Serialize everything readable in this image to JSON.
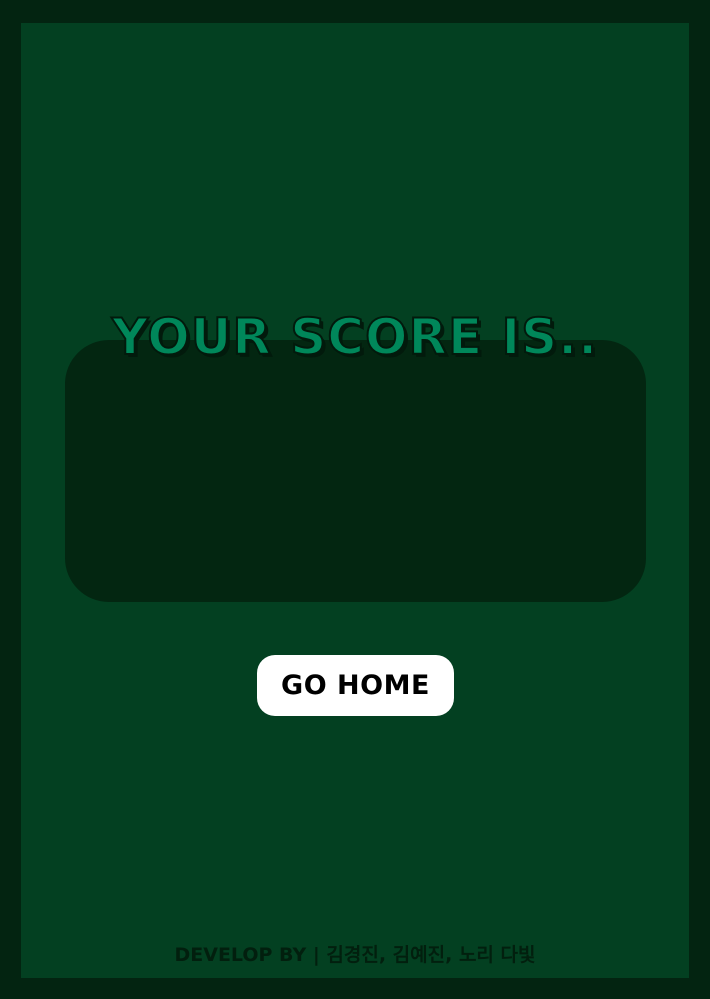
{
  "result": {
    "title": "YOUR SCORE IS..",
    "score": ""
  },
  "actions": {
    "home_label": "GO HOME"
  },
  "footer": {
    "credits": "DEVELOP BY | 김경진, 김예진, 노리 다빛"
  },
  "colors": {
    "outer_border": "#032411",
    "background": "#034021",
    "panel": "#032611",
    "title": "#00875A",
    "button": "#ffffff"
  }
}
